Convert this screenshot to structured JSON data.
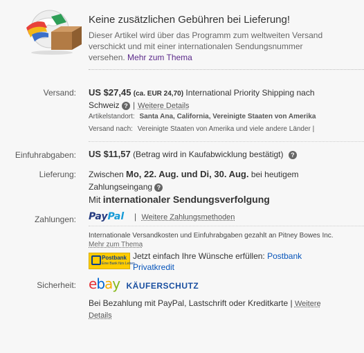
{
  "banner": {
    "title": "Keine zusätzlichen Gebühren bei Lieferung!",
    "desc_line1": "Dieser Artikel wird über das Programm zum weltweiten Versand",
    "desc_line2": "verschickt und mit einer internationalen Sendungsnummer",
    "desc_line3_prefix": "versehen.",
    "more_link": "Mehr zum Thema",
    "icon": "globe-package-icon"
  },
  "shipping": {
    "label": "Versand:",
    "price": "US $27,45",
    "approx": "(ca. EUR 24,70)",
    "service_line1": "International Priority Shipping nach",
    "service_line2": "Schweiz",
    "details_link": "Weitere Details",
    "location_label": "Artikelstandort:",
    "location_value": "Santa Ana, California, Vereinigte Staaten von Amerika",
    "shipto_label": "Versand nach:",
    "shipto_value": "Vereinigte Staaten von Amerika und viele andere Länder |"
  },
  "import": {
    "label": "Einfuhrabgaben:",
    "price": "US $11,57",
    "note": "(Betrag wird in Kaufabwicklung bestätigt)"
  },
  "delivery": {
    "label": "Lieferung:",
    "prefix": "Zwischen",
    "dates": "Mo, 22. Aug. und Di, 30. Aug.",
    "suffix": "bei heutigem",
    "line2": "Zahlungseingang",
    "tracking_prefix": "Mit",
    "tracking": "internationaler Sendungsverfolgung"
  },
  "payments": {
    "label": "Zahlungen:",
    "paypal_pay": "Pay",
    "paypal_pal": "Pal",
    "methods_link": "Weitere Zahlungsmethoden",
    "pitney_note": "Internationale Versandkosten und Einfuhrabgaben gezahlt an Pitney Bowes Inc.",
    "more_link": "Mehr zum Thema",
    "postbank_logo": "Postbank",
    "postbank_tagline": "Eine Bank fürs Leben.",
    "credit_text": "Jetzt einfach Ihre Wünsche erfüllen:",
    "credit_link1": "Postbank",
    "credit_link2": "Privatkredit"
  },
  "security": {
    "label": "Sicherheit:",
    "ebay_e": "e",
    "ebay_b": "b",
    "ebay_a": "a",
    "ebay_y": "y",
    "protection": "KÄUFERSCHUTZ",
    "note": "Bei Bezahlung mit PayPal, Lastschrift oder Kreditkarte |",
    "details1": "Weitere",
    "details2": "Details"
  },
  "colors": {
    "ebay_red": "#e53238",
    "ebay_blue": "#0064d2",
    "ebay_yellow": "#f5af02",
    "ebay_green": "#86b817",
    "paypal_dark": "#253b80",
    "paypal_light": "#179bd7",
    "postbank_yellow": "#ffcc00"
  }
}
